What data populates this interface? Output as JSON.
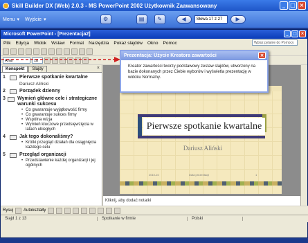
{
  "app": {
    "title": "Skill Builder DX (Web) 2.0.3 - MS PowerPoint 2002 Użytkownik Zaawansowany",
    "menu_label": "Menu",
    "exit_label": "Wyjście",
    "step_value": "Słowa 17 z 27",
    "nav_prev": "◀",
    "nav_next": "▶"
  },
  "pp": {
    "title": "Microsoft PowerPoint - [Prezentacja2]",
    "menu": [
      "Plik",
      "Edycja",
      "Widok",
      "Wstaw",
      "Format",
      "Narzędzia",
      "Pokaz slajdów",
      "Okno",
      "Pomoc"
    ],
    "help_box": "Wpisz pytanie do Pomocy",
    "font_name": "Arial",
    "font_size": "18",
    "tabs": [
      "Konspekt",
      "Slajdy"
    ],
    "tab_close": "×"
  },
  "outline": [
    {
      "num": "1",
      "title": "Pierwsze spotkanie kwartalne",
      "sub": "Dariusz Aliński",
      "bullets": []
    },
    {
      "num": "2",
      "title": "Porządek dzienny",
      "sub": "",
      "bullets": []
    },
    {
      "num": "3",
      "title": "Wymień główne cele i strategiczne warunki sukcesu",
      "sub": "",
      "bullets": [
        "Co gwarantuje wyjątkowość firmy",
        "Co gwarantuje sukces firmy",
        "Wspólna wizja",
        "Wymień kluczowe przedsięwzięcia w latach ubiegłych"
      ]
    },
    {
      "num": "4",
      "title": "Jak tego dokonaliśmy?",
      "sub": "",
      "bullets": [
        "Krótki przegląd działań dla osiągnięcia każdego celu"
      ]
    },
    {
      "num": "5",
      "title": "Przegląd organizacji",
      "sub": "",
      "bullets": [
        "Przedstawienie każdej organizacji i jej ogólnych"
      ]
    }
  ],
  "slide": {
    "title": "Pierwsze spotkanie kwartalne",
    "subtitle": "Dariusz Aliński",
    "footer_left": "2010-10",
    "footer_center": "Data prezentacji",
    "footer_right": "1"
  },
  "notes_placeholder": "Kliknij, aby dodać notatki",
  "drawbar": {
    "draw_label": "Rysuj",
    "autoshapes_label": "Autokształty"
  },
  "status": {
    "slide": "Slajd 1 z 13",
    "design": "Spotkanie w firmie",
    "language": "Polski"
  },
  "popup": {
    "title": "Prezentacja: Użycie Kreatora zawartości",
    "body": "Kreator zawartości tworzy podstawowy zestaw slajdów, utworzony na bazie dokonanych przez Ciebie wyborów i wyświetla prezentację w widoku Normalny.",
    "close": "×"
  },
  "colors": {
    "skill_titlebar": "#1f56c8",
    "pp_titlebar": "#0a3cb8",
    "arrow": "#d02020",
    "slide_bg": "#f5e9be"
  }
}
